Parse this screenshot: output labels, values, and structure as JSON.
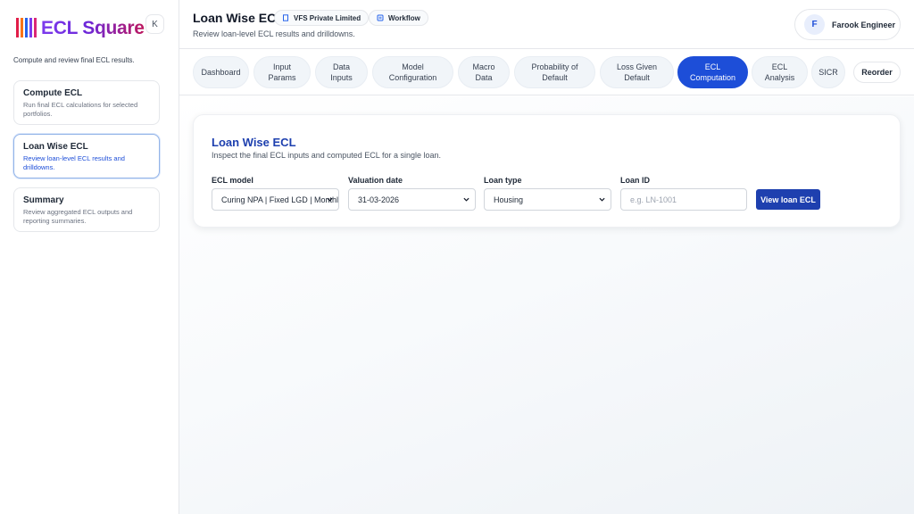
{
  "sidebar": {
    "logo_text": "ECL Square",
    "collapse_label": "K",
    "description": "Compute and review final ECL results.",
    "items": [
      {
        "title": "Compute ECL",
        "desc": "Run final ECL calculations for selected portfolios."
      },
      {
        "title": "Loan Wise ECL",
        "desc": "Review loan-level ECL results and drilldowns."
      },
      {
        "title": "Summary",
        "desc": "Review aggregated ECL outputs and reporting summaries."
      }
    ]
  },
  "header": {
    "title": "Loan Wise ECL",
    "subtitle": "Review loan-level ECL results and drilldowns.",
    "chip_company": "VFS Private Limited",
    "chip_workflow": "Workflow",
    "user_initial": "F",
    "user_name": "Farook Engineer"
  },
  "tabs": [
    {
      "label": "Dashboard"
    },
    {
      "label": "Input\nParams"
    },
    {
      "label": "Data\nInputs"
    },
    {
      "label": "Model\nConfiguration"
    },
    {
      "label": "Macro\nData"
    },
    {
      "label": "Probability of\nDefault"
    },
    {
      "label": "Loss Given\nDefault"
    },
    {
      "label": "ECL\nComputation"
    },
    {
      "label": "ECL\nAnalysis"
    },
    {
      "label": "SICR"
    }
  ],
  "active_tab": "ECL Computation",
  "reorder_label": "Reorder",
  "card": {
    "title": "Loan Wise ECL",
    "subtitle": "Inspect the final ECL inputs and computed ECL for a single loan.",
    "fields": {
      "ecl_model": {
        "label": "ECL model",
        "value": "Curing NPA | Fixed LGD | Monthly"
      },
      "valuation_date": {
        "label": "Valuation date",
        "value": "31-03-2026"
      },
      "loan_type": {
        "label": "Loan type",
        "value": "Housing"
      },
      "loan_id": {
        "label": "Loan ID",
        "placeholder": "e.g. LN-1001"
      }
    },
    "button_label": "View loan ECL"
  },
  "colors": {
    "accent": "#1d4ed8",
    "primary_button": "#1e40af",
    "logo_gradient": [
      "#e11d48",
      "#f59e0b",
      "#2563eb",
      "#7c3aed"
    ]
  }
}
